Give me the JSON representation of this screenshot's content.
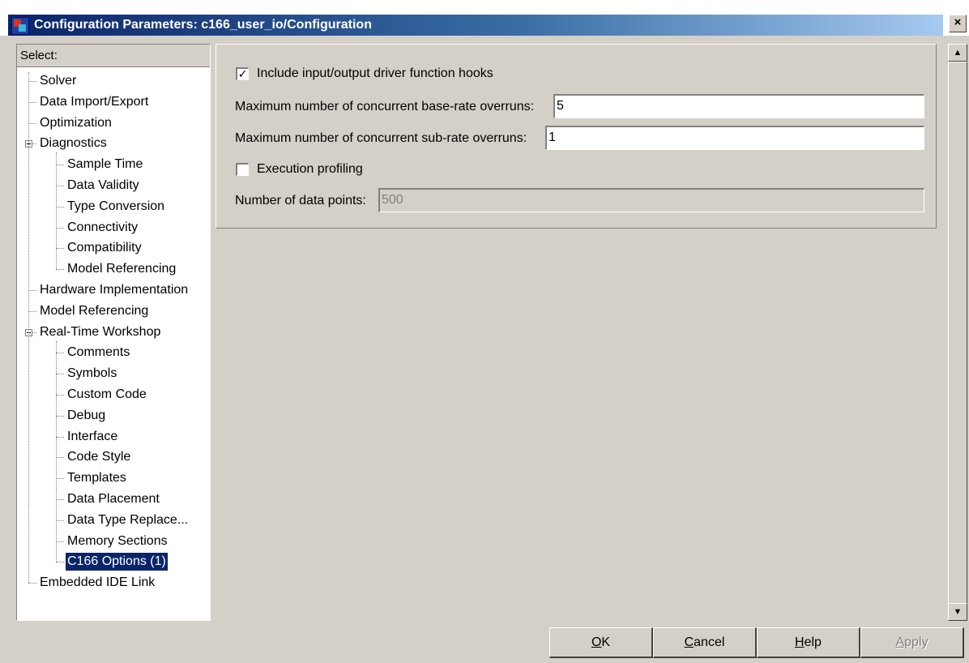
{
  "window": {
    "title": "Configuration Parameters: c166_user_io/Configuration",
    "close_label": "×"
  },
  "tree": {
    "header": "Select:",
    "items": [
      {
        "label": "Solver",
        "level": 1
      },
      {
        "label": "Data Import/Export",
        "level": 1
      },
      {
        "label": "Optimization",
        "level": 1
      },
      {
        "label": "Diagnostics",
        "level": 1,
        "expanded": true
      },
      {
        "label": "Sample Time",
        "level": 2
      },
      {
        "label": "Data Validity",
        "level": 2
      },
      {
        "label": "Type Conversion",
        "level": 2
      },
      {
        "label": "Connectivity",
        "level": 2
      },
      {
        "label": "Compatibility",
        "level": 2
      },
      {
        "label": "Model Referencing",
        "level": 2
      },
      {
        "label": "Hardware Implementation",
        "level": 1
      },
      {
        "label": "Model Referencing",
        "level": 1
      },
      {
        "label": "Real-Time Workshop",
        "level": 1,
        "expanded": true
      },
      {
        "label": "Comments",
        "level": 2
      },
      {
        "label": "Symbols",
        "level": 2
      },
      {
        "label": "Custom Code",
        "level": 2
      },
      {
        "label": "Debug",
        "level": 2
      },
      {
        "label": "Interface",
        "level": 2
      },
      {
        "label": "Code Style",
        "level": 2
      },
      {
        "label": "Templates",
        "level": 2
      },
      {
        "label": "Data Placement",
        "level": 2
      },
      {
        "label": "Data Type Replace...",
        "level": 2
      },
      {
        "label": "Memory Sections",
        "level": 2
      },
      {
        "label": "C166 Options (1)",
        "level": 2,
        "selected": true
      },
      {
        "label": "Embedded IDE Link",
        "level": 1
      }
    ]
  },
  "options": {
    "include_hooks": {
      "label": "Include input/output driver function hooks",
      "checked": true,
      "mark": "✓"
    },
    "base_rate": {
      "label": "Maximum number of concurrent base-rate overruns:",
      "value": "5"
    },
    "sub_rate": {
      "label": "Maximum number of concurrent sub-rate overruns:",
      "value": "1"
    },
    "profiling": {
      "label": "Execution profiling",
      "checked": false,
      "mark": ""
    },
    "data_points": {
      "label": "Number of data points:",
      "value": "500",
      "disabled": true
    }
  },
  "scrollbar": {
    "up_icon": "▲",
    "down_icon": "▼"
  },
  "buttons": {
    "ok": {
      "mnemonic": "O",
      "rest": "K"
    },
    "cancel": {
      "mnemonic": "C",
      "rest": "ancel"
    },
    "help": {
      "mnemonic": "H",
      "rest": "elp"
    },
    "apply": {
      "mnemonic": "A",
      "rest": "pply",
      "disabled": true
    }
  },
  "colors": {
    "face": "#d4d0c8",
    "selection": "#0a246a",
    "title_start": "#0a246a",
    "title_end": "#a6caf0"
  }
}
